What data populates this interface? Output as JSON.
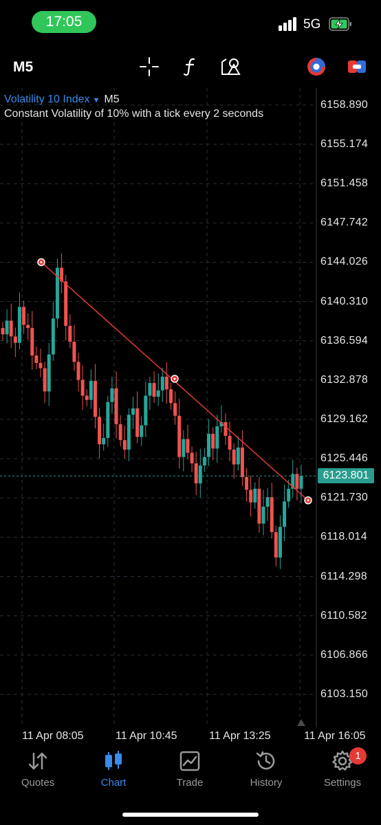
{
  "status_bar": {
    "time": "17:05",
    "network": "5G",
    "battery_state": "charging",
    "accent_color": "#31c65a"
  },
  "toolbar": {
    "timeframe": "M5",
    "icons": [
      "crosshair-icon",
      "indicators-f-icon",
      "objects-shapes-icon",
      "theme-toggle-icon",
      "one-click-trading-icon"
    ]
  },
  "chart": {
    "symbol": "Volatility 10 Index",
    "timeframe": "M5",
    "description": "Constant Volatility of 10% with a tick every 2 seconds",
    "current_price": "6123.801",
    "colors": {
      "bull": "#26a69a",
      "bear": "#ef5350",
      "trendline": "#e53935",
      "bid_line": "#2a9d8f"
    }
  },
  "chart_data": {
    "type": "candlestick",
    "price_axis": [
      "6158.890",
      "6155.174",
      "6151.458",
      "6147.742",
      "6144.026",
      "6140.310",
      "6136.594",
      "6132.878",
      "6129.162",
      "6125.446",
      "6121.730",
      "6118.014",
      "6114.298",
      "6110.582",
      "6106.866",
      "6103.150"
    ],
    "time_axis": [
      "11 Apr 08:05",
      "11 Apr 10:45",
      "11 Apr 13:25",
      "11 Apr 16:05"
    ],
    "ylim": [
      6101.2,
      6159.2
    ],
    "grid": true,
    "current_price": 6123.801,
    "candle_count": 72,
    "closes": [
      6137.2,
      6138.5,
      6137.0,
      6136.4,
      6139.8,
      6138.1,
      6137.8,
      6135.2,
      6134.5,
      6134.0,
      6131.8,
      6135.3,
      6138.7,
      6143.5,
      6142.2,
      6138.0,
      6136.5,
      6134.6,
      6132.9,
      6131.4,
      6131.0,
      6132.8,
      6129.4,
      6126.8,
      6127.4,
      6130.8,
      6132.1,
      6128.7,
      6127.2,
      6126.3,
      6129.6,
      6130.2,
      6127.5,
      6128.6,
      6131.4,
      6132.6,
      6131.3,
      6131.9,
      6133.2,
      6132.0,
      6130.7,
      6129.5,
      6125.6,
      6127.3,
      6126.0,
      6125.0,
      6123.1,
      6124.8,
      6125.6,
      6127.8,
      6126.4,
      6128.5,
      6128.9,
      6127.6,
      6126.3,
      6124.9,
      6126.5,
      6123.7,
      6122.5,
      6121.3,
      6122.6,
      6119.3,
      6120.9,
      6121.8,
      6118.5,
      6116.1,
      6119.0,
      6121.4,
      6122.6,
      6124.0,
      6122.6,
      6123.8
    ],
    "trendline": {
      "points": [
        {
          "x": "11 Apr 07:35",
          "y": 6144.026
        },
        {
          "x": "11 Apr 12:00",
          "y": 6133.0
        },
        {
          "x": "11 Apr 15:50",
          "y": 6121.5
        }
      ]
    }
  },
  "tab_bar": {
    "tabs": [
      {
        "id": "quotes",
        "label": "Quotes",
        "icon": "quotes-arrows-icon",
        "active": false
      },
      {
        "id": "chart",
        "label": "Chart",
        "icon": "candlestick-icon",
        "active": true
      },
      {
        "id": "trade",
        "label": "Trade",
        "icon": "trade-chart-icon",
        "active": false
      },
      {
        "id": "history",
        "label": "History",
        "icon": "history-clock-icon",
        "active": false
      },
      {
        "id": "settings",
        "label": "Settings",
        "icon": "gear-icon",
        "active": false
      }
    ],
    "settings_badge": "1",
    "active_color": "#3b8bea"
  }
}
